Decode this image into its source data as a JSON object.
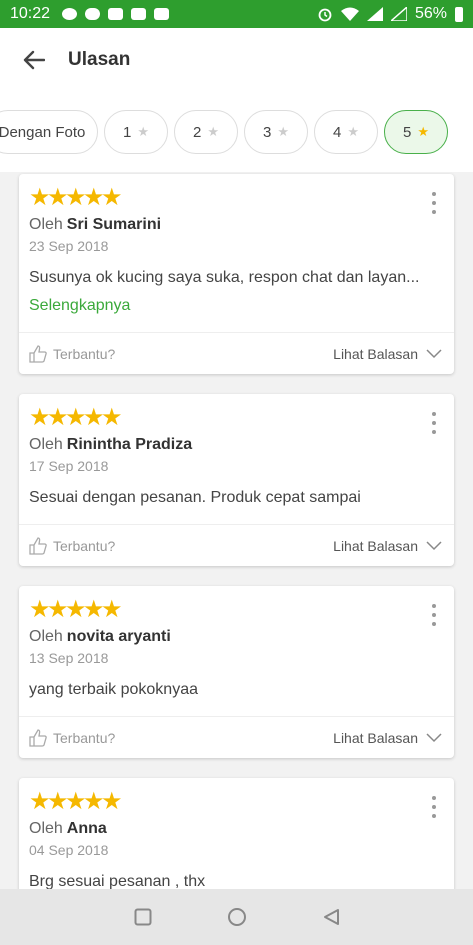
{
  "status": {
    "time": "10:22",
    "battery": "56%"
  },
  "header": {
    "title": "Ulasan"
  },
  "filters": [
    {
      "label": "Dengan Foto",
      "star": false,
      "active": false
    },
    {
      "label": "1",
      "star": true,
      "active": false
    },
    {
      "label": "2",
      "star": true,
      "active": false
    },
    {
      "label": "3",
      "star": true,
      "active": false
    },
    {
      "label": "4",
      "star": true,
      "active": false
    },
    {
      "label": "5",
      "star": true,
      "active": true
    }
  ],
  "reviews": [
    {
      "by": "Oleh",
      "name": "Sri Sumarini",
      "date": "23 Sep 2018",
      "text": "Susunya ok kucing saya suka, respon chat dan layan...",
      "readmore": "Selengkapnya",
      "rating": 5
    },
    {
      "by": "Oleh",
      "name": "Rinintha Pradiza",
      "date": "17 Sep 2018",
      "text": "Sesuai dengan pesanan. Produk cepat sampai",
      "rating": 5
    },
    {
      "by": "Oleh",
      "name": "novita aryanti",
      "date": "13 Sep 2018",
      "text": "yang terbaik pokoknyaa",
      "rating": 5
    },
    {
      "by": "Oleh",
      "name": "Anna",
      "date": "04 Sep 2018",
      "text": "Brg sesuai pesanan , thx",
      "rating": 5
    }
  ],
  "footer": {
    "helpful": "Terbantu?",
    "reply": "Lihat Balasan"
  },
  "colors": {
    "statusbar": "#2e9e2e",
    "accent_green": "#3aa93a",
    "star": "#f5b800"
  },
  "icons": {
    "back": "arrow-left-icon",
    "more": "more-vertical-icon",
    "helpful": "thumbs-up-icon",
    "reply": "chevron-down-icon"
  }
}
